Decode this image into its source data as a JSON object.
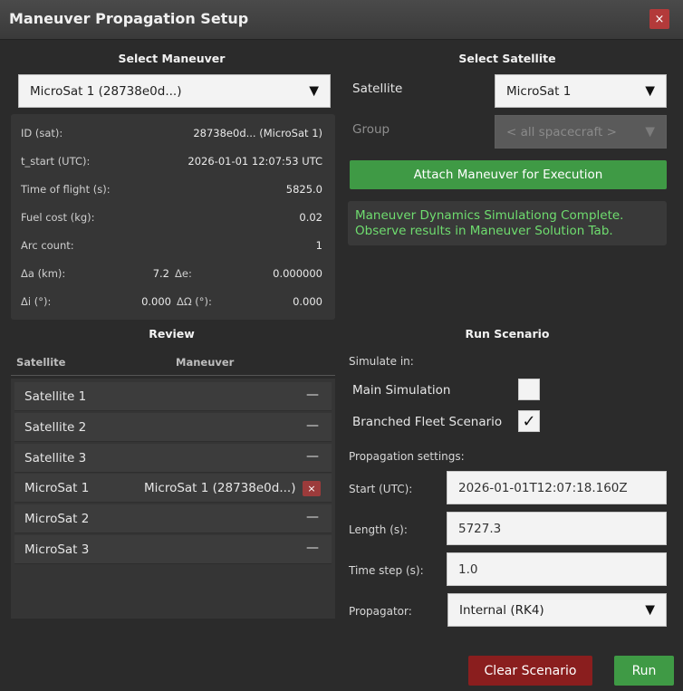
{
  "window": {
    "title": "Maneuver Propagation Setup",
    "close_label": "×"
  },
  "select_maneuver": {
    "heading": "Select Maneuver",
    "selected": "MicroSat 1 (28738e0d...)",
    "arrow": "▼",
    "details": [
      {
        "label": "ID (sat):",
        "value": "28738e0d... (MicroSat 1)"
      },
      {
        "label": "t_start (UTC):",
        "value": "2026-01-01 12:07:53 UTC"
      },
      {
        "label": "Time of flight (s):",
        "value": "5825.0"
      },
      {
        "label": "Fuel cost (kg):",
        "value": "0.02"
      },
      {
        "label": "Arc count:",
        "value": "1"
      }
    ],
    "pairs": [
      {
        "label1": "Δa (km):",
        "value1": "7.2",
        "label2": "Δe:",
        "value2": "0.000000"
      },
      {
        "label1": "Δi (°):",
        "value1": "0.000",
        "label2": "ΔΩ (°):",
        "value2": "0.000"
      }
    ]
  },
  "select_satellite": {
    "heading": "Select Satellite",
    "satellite_label": "Satellite",
    "satellite_value": "MicroSat 1",
    "group_label": "Group",
    "group_value": "< all spacecraft >",
    "attach_label": "Attach Maneuver for Execution",
    "message_line1": "Maneuver Dynamics Simulationg Complete.",
    "message_line2": "Observe results in Maneuver Solution Tab."
  },
  "review": {
    "heading": "Review",
    "col_satellite": "Satellite",
    "col_maneuver": "Maneuver",
    "dash": "—",
    "remove_label": "×",
    "rows": [
      {
        "satellite": "Satellite 1",
        "maneuver": ""
      },
      {
        "satellite": "Satellite 2",
        "maneuver": ""
      },
      {
        "satellite": "Satellite 3",
        "maneuver": ""
      },
      {
        "satellite": "MicroSat 1",
        "maneuver": "MicroSat 1 (28738e0d...)"
      },
      {
        "satellite": "MicroSat 2",
        "maneuver": ""
      },
      {
        "satellite": "MicroSat 3",
        "maneuver": ""
      }
    ]
  },
  "run_scenario": {
    "heading": "Run Scenario",
    "simulate_in": "Simulate in:",
    "main_sim_label": "Main Simulation",
    "main_sim_checked": false,
    "branched_label": "Branched Fleet Scenario",
    "branched_checked": true,
    "check_glyph": "✓",
    "propagation_settings": "Propagation settings:",
    "start_label": "Start (UTC):",
    "start_value": "2026-01-01T12:07:18.160Z",
    "length_label": "Length (s):",
    "length_value": "5727.3",
    "timestep_label": "Time step (s):",
    "timestep_value": "1.0",
    "propagator_label": "Propagator:",
    "propagator_value": "Internal (RK4)"
  },
  "actions": {
    "clear_label": "Clear Scenario",
    "run_label": "Run"
  },
  "colors": {
    "accent_green": "#3f9a45",
    "danger_red": "#8a1e1e",
    "message_green": "#6fdd6f"
  }
}
